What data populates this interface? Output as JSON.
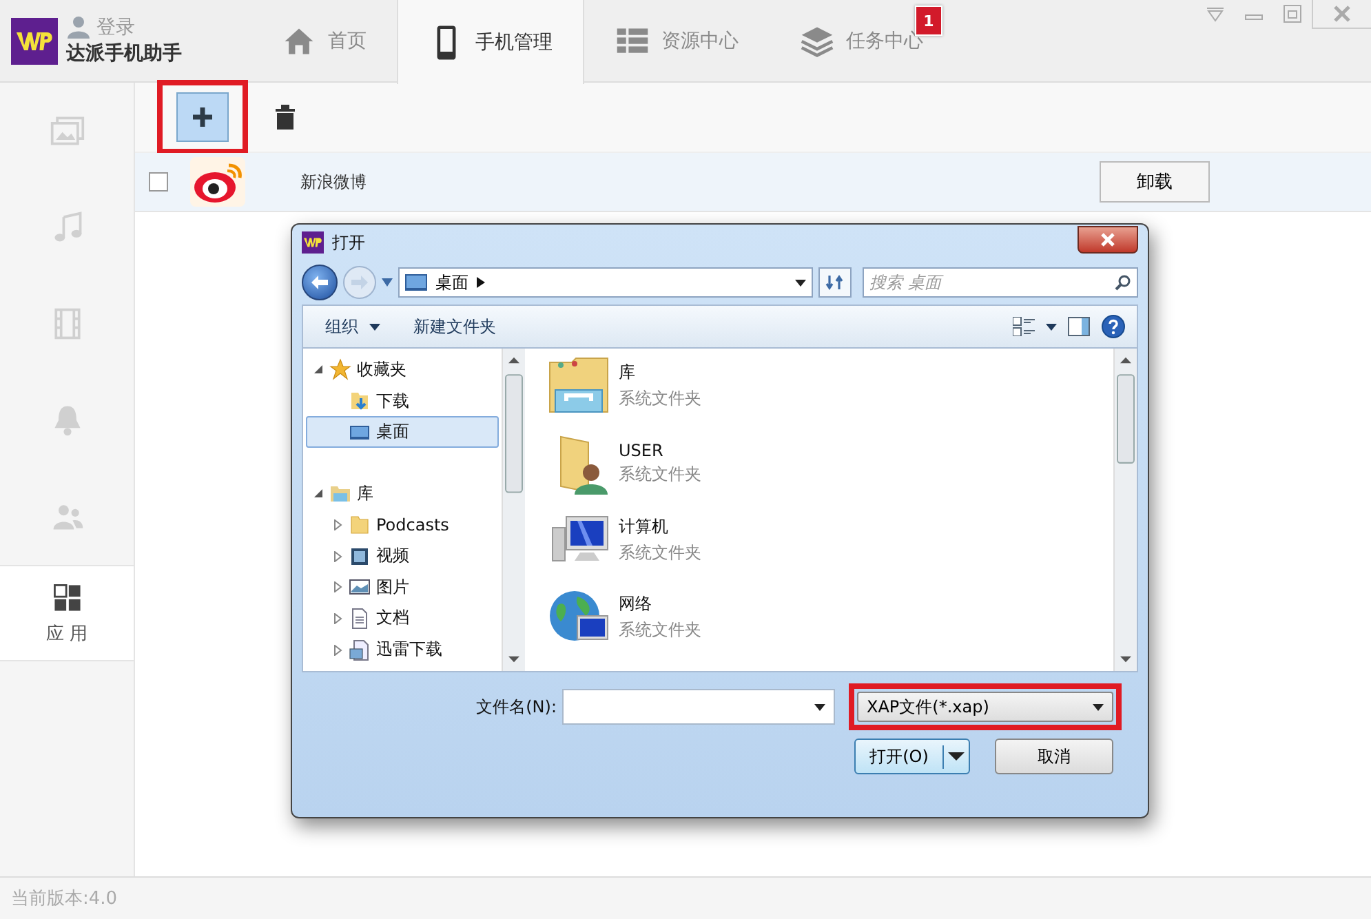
{
  "app": {
    "name": "达派手机助手",
    "login": "登录"
  },
  "tabs": [
    {
      "label": "首页",
      "selected": false
    },
    {
      "label": "手机管理",
      "selected": true
    },
    {
      "label": "资源中心",
      "selected": false
    },
    {
      "label": "任务中心",
      "selected": false,
      "badge": "1"
    }
  ],
  "sidebar": {
    "items": [
      {
        "selected": false
      },
      {
        "selected": false
      },
      {
        "selected": false
      },
      {
        "selected": false
      },
      {
        "selected": false
      },
      {
        "label": "应 用",
        "selected": true
      }
    ]
  },
  "apps": [
    {
      "name": "新浪微博",
      "checked": false,
      "action": "卸载"
    }
  ],
  "dialog": {
    "title": "打开",
    "address": "桌面",
    "search": {
      "placeholder": "搜索 桌面"
    },
    "toolbar": {
      "organize": "组织",
      "new_folder": "新建文件夹"
    },
    "tree": [
      {
        "label": "收藏夹",
        "expanded": true,
        "children": [
          {
            "label": "下载",
            "selected": false
          },
          {
            "label": "桌面",
            "selected": true
          }
        ]
      },
      {
        "label": "库",
        "expanded": true,
        "children": [
          {
            "label": "Podcasts",
            "expanded": false
          },
          {
            "label": "视频",
            "expanded": false
          },
          {
            "label": "图片",
            "expanded": false
          },
          {
            "label": "文档",
            "expanded": false
          },
          {
            "label": "迅雷下载",
            "expanded": false
          }
        ]
      }
    ],
    "files": [
      {
        "name": "库",
        "type": "系统文件夹"
      },
      {
        "name": "USER",
        "type": "系统文件夹"
      },
      {
        "name": "计算机",
        "type": "系统文件夹"
      },
      {
        "name": "网络",
        "type": "系统文件夹"
      }
    ],
    "file_name_label": "文件名(N):",
    "file_type": "XAP文件(*.xap)",
    "open_button": "打开(O)",
    "cancel_button": "取消"
  },
  "status_bar": {
    "version": "当前版本:4.0"
  }
}
